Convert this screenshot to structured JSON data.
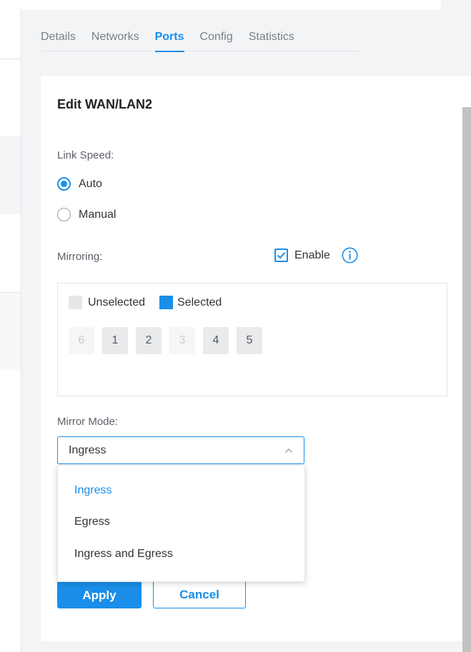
{
  "tabs": [
    {
      "label": "Details"
    },
    {
      "label": "Networks"
    },
    {
      "label": "Ports"
    },
    {
      "label": "Config"
    },
    {
      "label": "Statistics"
    }
  ],
  "active_tab": "Ports",
  "panel": {
    "title": "Edit WAN/LAN2",
    "link_speed_label": "Link Speed:",
    "link_speed_options": [
      "Auto",
      "Manual"
    ],
    "link_speed_selected": "Auto",
    "mirroring_label": "Mirroring:",
    "enable_label": "Enable",
    "enable_checked": true,
    "legend_unselected": "Unselected",
    "legend_selected": "Selected",
    "ports": [
      {
        "label": "6",
        "state": "disabled"
      },
      {
        "label": "1",
        "state": "unselected"
      },
      {
        "label": "2",
        "state": "unselected"
      },
      {
        "label": "3",
        "state": "disabled"
      },
      {
        "label": "4",
        "state": "unselected"
      },
      {
        "label": "5",
        "state": "unselected"
      }
    ],
    "mirror_mode_label": "Mirror Mode:",
    "mirror_mode_value": "Ingress",
    "mirror_mode_options": [
      "Ingress",
      "Egress",
      "Ingress and Egress"
    ],
    "apply_label": "Apply",
    "cancel_label": "Cancel"
  },
  "colors": {
    "accent": "#1a8ee8",
    "port_unselected": "#e9eaec",
    "port_disabled": "#f5f6f7"
  }
}
